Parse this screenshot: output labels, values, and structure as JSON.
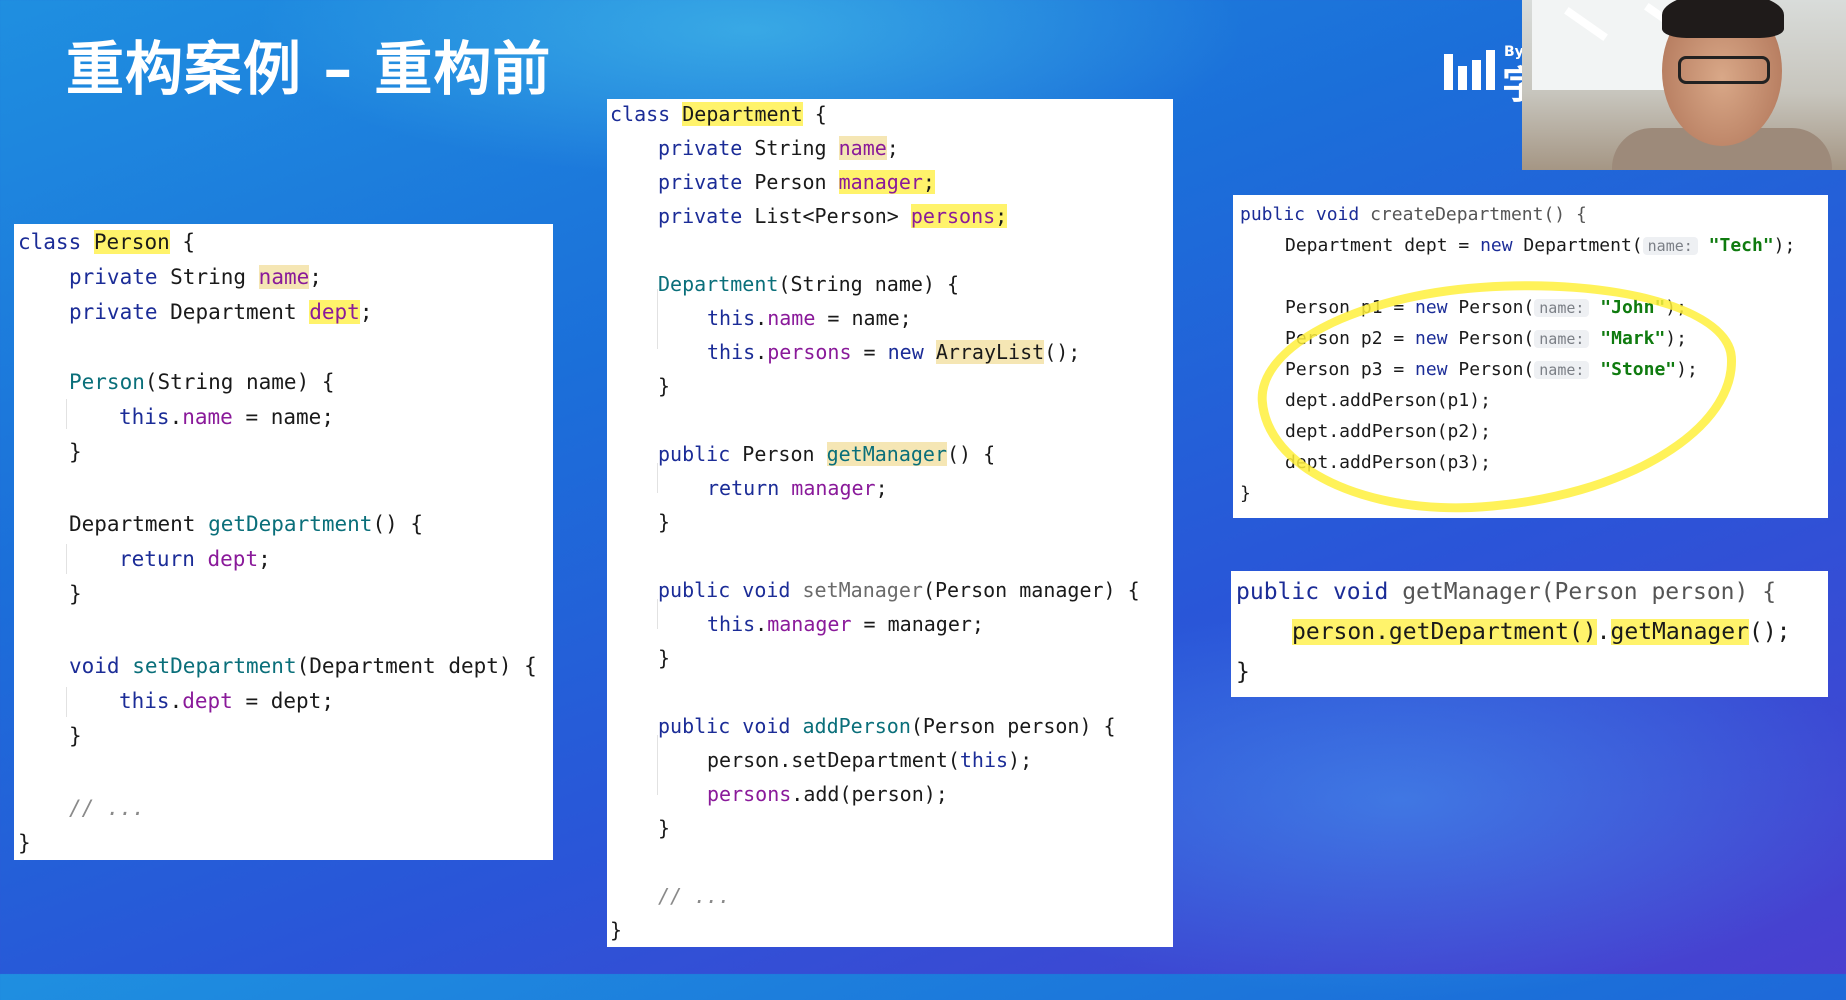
{
  "slide_title": "重构案例 – 重构前",
  "person_class": {
    "l1": [
      "class",
      " ",
      "Person",
      " {"
    ],
    "l2": [
      "private",
      " String ",
      "name",
      ";"
    ],
    "l3": [
      "private",
      " Department ",
      "dept",
      ";"
    ],
    "l5": [
      "Person",
      "(String name) {"
    ],
    "l6": [
      "this",
      ".",
      "name",
      " = name;"
    ],
    "l7": "}",
    "l9": [
      "Department ",
      "getDepartment",
      "() {"
    ],
    "l10": [
      "return",
      " ",
      "dept",
      ";"
    ],
    "l11": "}",
    "l13": [
      "void",
      " ",
      "setDepartment",
      "(Department dept) {"
    ],
    "l14": [
      "this",
      ".",
      "dept",
      " = dept;"
    ],
    "l15": "}",
    "l17": "// ...",
    "l18": "}"
  },
  "department_class": {
    "l1": [
      "class",
      " ",
      "Department",
      " {"
    ],
    "l2": [
      "private",
      " String ",
      "name",
      ";"
    ],
    "l3": [
      "private",
      " Person ",
      "manager",
      ";"
    ],
    "l4": [
      "private",
      " List<Person> ",
      "persons",
      ";"
    ],
    "l6": [
      "Department",
      "(String name) {"
    ],
    "l7": [
      "this",
      ".",
      "name",
      " = name;"
    ],
    "l8": [
      "this",
      ".",
      "persons",
      " = ",
      "new",
      " ",
      "ArrayList",
      "();"
    ],
    "l9": "}",
    "l11": [
      "public",
      " Person ",
      "getManager",
      "() {"
    ],
    "l12": [
      "return",
      " ",
      "manager",
      ";"
    ],
    "l13": "}",
    "l15": [
      "public",
      " ",
      "void",
      " ",
      "setManager",
      "(Person manager) {"
    ],
    "l16": [
      "this",
      ".",
      "manager",
      " = manager;"
    ],
    "l17": "}",
    "l19": [
      "public",
      " ",
      "void",
      " ",
      "addPerson",
      "(Person person) {"
    ],
    "l20": [
      "person.setDepartment(",
      "this",
      ");"
    ],
    "l21": [
      "persons",
      ".add(person);"
    ],
    "l22": "}",
    "l24": "// ...",
    "l25": "}"
  },
  "create_department": {
    "l1": [
      "public",
      " ",
      "void",
      " createDepartment() {"
    ],
    "l2": [
      "Department dept = ",
      "new",
      " Department(",
      "name:",
      " ",
      "\"Tech\"",
      ");"
    ],
    "l4": [
      "Person p1 = ",
      "new",
      " Person(",
      "name:",
      " ",
      "\"John\"",
      ");"
    ],
    "l5": [
      "Person p2 = ",
      "new",
      " Person(",
      "name:",
      " ",
      "\"Mark\"",
      ");"
    ],
    "l6": [
      "Person p3 = ",
      "new",
      " Person(",
      "name:",
      " ",
      "\"Stone\"",
      ");"
    ],
    "l7": "dept.addPerson(p1);",
    "l8": "dept.addPerson(p2);",
    "l9": "dept.addPerson(p3);",
    "l10": "}"
  },
  "get_manager_snippet": {
    "l1": [
      "public",
      " ",
      "void",
      " getManager(Person person) {"
    ],
    "l2": [
      "person.getDepartment()",
      ".",
      "getManager",
      "();"
    ],
    "l3": "}"
  },
  "logo": {
    "top_text": "By",
    "glyph": "字"
  },
  "colors": {
    "keyword": "#1b2c97",
    "function": "#0a6f7a",
    "field": "#8a1a9a",
    "string": "#0f7b0f",
    "highlight": "#fff36b"
  }
}
